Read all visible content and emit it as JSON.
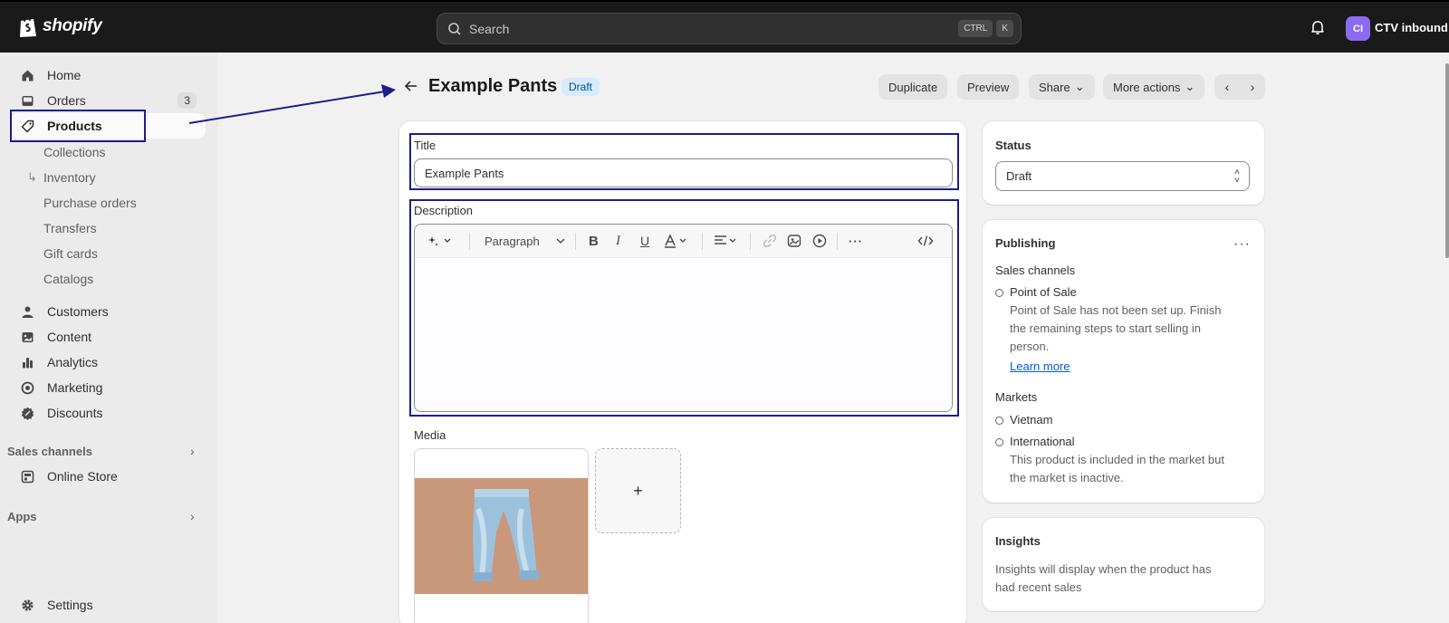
{
  "topbar": {
    "brand": "shopify",
    "search_placeholder": "Search",
    "shortcut_keys": [
      "CTRL",
      "K"
    ],
    "avatar_initials": "CI",
    "store_name": "CTV inbound"
  },
  "sidebar": {
    "items": [
      {
        "label": "Home",
        "icon": "home-icon"
      },
      {
        "label": "Orders",
        "icon": "inbox-icon",
        "badge": "3"
      },
      {
        "label": "Products",
        "icon": "tag-icon",
        "active": true
      }
    ],
    "product_subitems": [
      "Collections",
      "Inventory",
      "Purchase orders",
      "Transfers",
      "Gift cards",
      "Catalogs"
    ],
    "items2": [
      {
        "label": "Customers",
        "icon": "person-icon"
      },
      {
        "label": "Content",
        "icon": "image-icon"
      },
      {
        "label": "Analytics",
        "icon": "bar-chart-icon"
      },
      {
        "label": "Marketing",
        "icon": "target-icon"
      },
      {
        "label": "Discounts",
        "icon": "discount-icon"
      }
    ],
    "sales_channels_label": "Sales channels",
    "online_store_label": "Online Store",
    "apps_label": "Apps",
    "settings_label": "Settings"
  },
  "header": {
    "title": "Example Pants",
    "status_badge": "Draft",
    "buttons": {
      "duplicate": "Duplicate",
      "preview": "Preview",
      "share": "Share",
      "more_actions": "More actions"
    }
  },
  "main": {
    "title_label": "Title",
    "title_value": "Example Pants",
    "description_label": "Description",
    "toolbar": {
      "paragraph_label": "Paragraph"
    },
    "media_label": "Media",
    "add_media_symbol": "+"
  },
  "status_card": {
    "heading": "Status",
    "selected": "Draft"
  },
  "publishing_card": {
    "heading": "Publishing",
    "sales_channels_heading": "Sales channels",
    "channel_name": "Point of Sale",
    "channel_note_lines": [
      "Point of Sale has not been set up. Finish",
      "the remaining steps to start selling in",
      "person."
    ],
    "learn_more": "Learn more",
    "markets_heading": "Markets",
    "markets": [
      "Vietnam",
      "International"
    ],
    "market_note_lines": [
      "This product is included in the market but",
      "the market is inactive."
    ]
  },
  "insights_card": {
    "heading": "Insights",
    "note_lines": [
      "Insights will display when the product has",
      "had recent sales"
    ]
  },
  "colors": {
    "topbar": "#1a1a1a",
    "annotation": "#1a1f8a",
    "draft_badge": "#d5ebff",
    "link": "#005bd3"
  }
}
